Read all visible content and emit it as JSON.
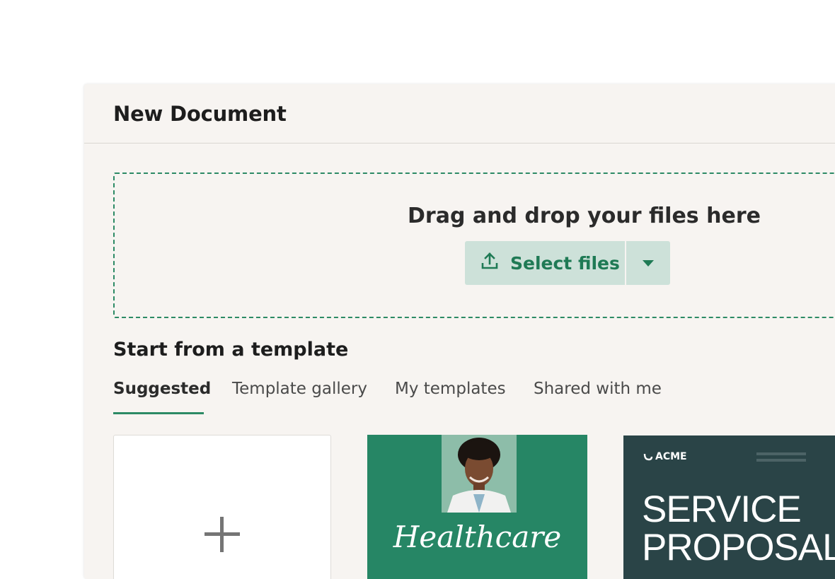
{
  "dialog": {
    "title": "New Document"
  },
  "upload": {
    "heading": "Drag and drop your files here",
    "select_label": "Select files",
    "upload_icon": "upload-icon",
    "dropdown_icon": "caret-down-icon"
  },
  "templates": {
    "heading": "Start from a template",
    "tabs": [
      {
        "label": "Suggested",
        "active": true
      },
      {
        "label": "Template gallery",
        "active": false
      },
      {
        "label": "My templates",
        "active": false
      },
      {
        "label": "Shared with me",
        "active": false
      }
    ],
    "cards": [
      {
        "kind": "blank",
        "icon": "plus-icon"
      },
      {
        "kind": "template",
        "title": "Healthcare"
      },
      {
        "kind": "template",
        "brand": "ACME",
        "title_line1": "SERVICE",
        "title_line2": "PROPOSAL"
      }
    ]
  },
  "colors": {
    "accent": "#2c8a65",
    "button_bg": "#cde1d9",
    "dialog_bg": "#f7f4f1",
    "healthcare_card": "#268665",
    "acme_card": "#2a4447"
  }
}
